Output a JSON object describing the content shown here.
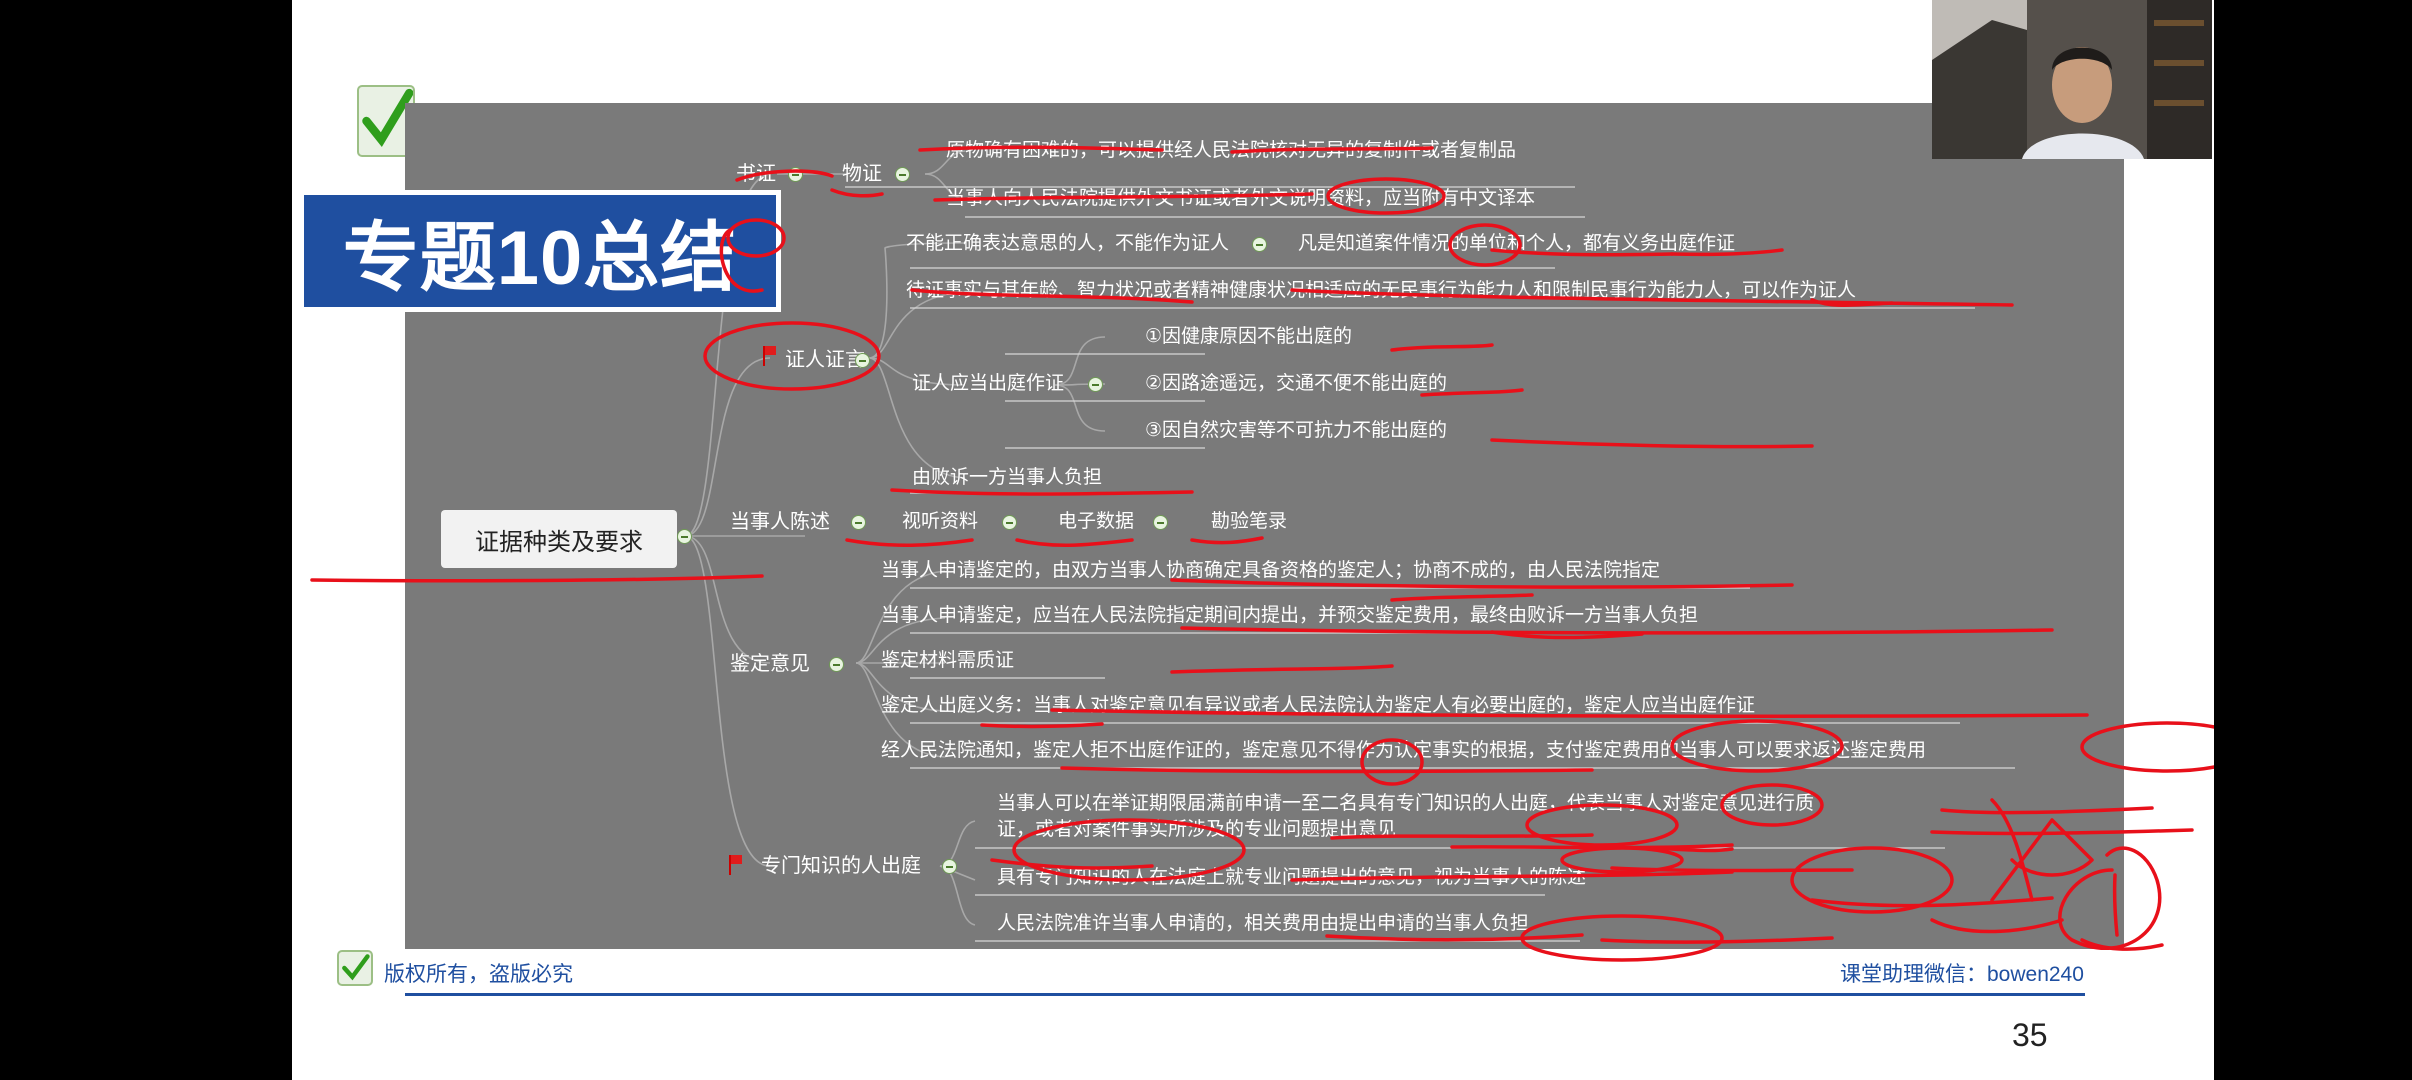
{
  "slide": {
    "title": "专题10总结",
    "root": "证据种类及要求",
    "copyright": "版权所有，盗版必究",
    "wechat": "课堂助理微信：bowen240",
    "page_number": "35"
  },
  "mindmap": {
    "shuzheng": "书证",
    "wuzheng": "物证",
    "wuzheng_1": "原物确有困难的，可以提供经人民法院核对无异的复制件或者复制品",
    "wuzheng_2": "当事人向人民法院提供外文书证或者外文说明资料，应当附有中文译本",
    "zhengren": "证人证言",
    "zr_1": "不能正确表达意思的人，不能作为证人",
    "zr_1b": "凡是知道案件情况的单位和个人，都有义务出庭作证",
    "zr_2": "待证事实与其年龄、智力状况或者精神健康状况相适应的无民事行为能力人和限制民事行为能力人，可以作为证人",
    "zr_3": "证人应当出庭作证",
    "zr_3a": "①因健康原因不能出庭的",
    "zr_3b": "②因路途遥远，交通不便不能出庭的",
    "zr_3c": "③因自然灾害等不可抗力不能出庭的",
    "zr_4": "由败诉一方当事人负担",
    "chenshu": "当事人陈述",
    "shiting": "视听资料",
    "dianzi": "电子数据",
    "kanyan": "勘验笔录",
    "jianding": "鉴定意见",
    "jd_1": "当事人申请鉴定的，由双方当事人协商确定具备资格的鉴定人；协商不成的，由人民法院指定",
    "jd_2": "当事人申请鉴定，应当在人民法院指定期间内提出，并预交鉴定费用，最终由败诉一方当事人负担",
    "jd_3": "鉴定材料需质证",
    "jd_4": "鉴定人出庭义务：当事人对鉴定意见有异议或者人民法院认为鉴定人有必要出庭的，鉴定人应当出庭作证",
    "jd_5": "经人民法院通知，鉴定人拒不出庭作证的，鉴定意见不得作为认定事实的根据，支付鉴定费用的当事人可以要求返还鉴定费用",
    "zhuanmen": "专门知识的人出庭",
    "zm_1a": "当事人可以在举证期限届满前申请一至二名具有专门知识的人出庭，代表当事人对鉴定意见进行质",
    "zm_1b": "证，或者对案件事实所涉及的专业问题提出意见",
    "zm_2": "具有专门知识的人在法庭上就专业问题提出的意见，视为当事人的陈述",
    "zm_3": "人民法院准许当事人申请的，相关费用由提出申请的当事人负担"
  },
  "icons": [
    "check-icon",
    "flag-icon",
    "collapse-icon"
  ],
  "colors": {
    "mindmap_bg": "#7a7a7a",
    "title_bg": "#1f4fa0",
    "annotation": "#e8101a",
    "footer": "#1f4fa0"
  }
}
